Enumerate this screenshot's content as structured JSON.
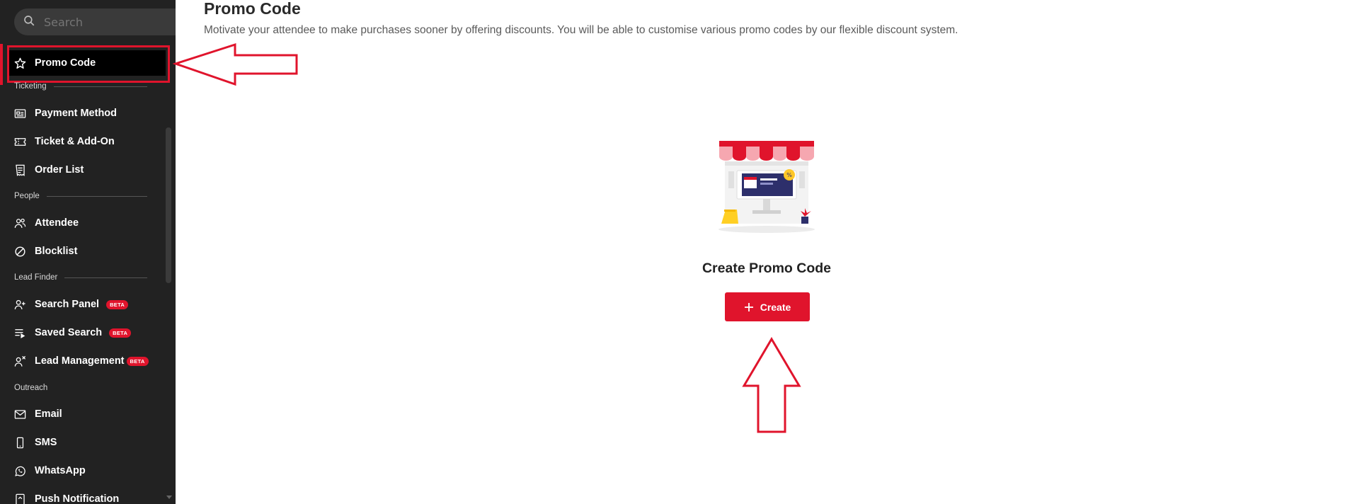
{
  "search": {
    "placeholder": "Search"
  },
  "sidebar": {
    "active_item": {
      "label": "Promo Code",
      "icon": "star-icon"
    },
    "sections": [
      {
        "label": "Ticketing"
      },
      {
        "label": "People"
      },
      {
        "label": "Lead Finder"
      },
      {
        "label": "Outreach"
      }
    ],
    "items": [
      {
        "label": "Payment Method",
        "icon": "payment-icon"
      },
      {
        "label": "Ticket & Add-On",
        "icon": "ticket-icon"
      },
      {
        "label": "Order List",
        "icon": "receipt-icon"
      },
      {
        "label": "Attendee",
        "icon": "users-icon"
      },
      {
        "label": "Blocklist",
        "icon": "block-icon"
      },
      {
        "label": "Search Panel",
        "icon": "user-plus-icon",
        "badge": "BETA"
      },
      {
        "label": "Saved Search",
        "icon": "list-play-icon",
        "badge": "BETA"
      },
      {
        "label": "Lead Management",
        "icon": "user-x-icon",
        "badge": "BETA"
      },
      {
        "label": "Email",
        "icon": "mail-icon"
      },
      {
        "label": "SMS",
        "icon": "phone-icon"
      },
      {
        "label": "WhatsApp",
        "icon": "whatsapp-icon"
      },
      {
        "label": "Push Notification",
        "icon": "notification-icon"
      }
    ]
  },
  "main": {
    "title": "Promo Code",
    "description": "Motivate your attendee to make purchases sooner by offering discounts. You will be able to customise various promo codes by our flexible discount system.",
    "empty_state": {
      "illustration": "storefront-illustration",
      "title": "Create Promo Code",
      "button_label": "Create",
      "button_icon": "plus-icon"
    }
  },
  "colors": {
    "accent": "#e0142c",
    "sidebar_bg": "#222222",
    "active_bg": "#000000"
  }
}
